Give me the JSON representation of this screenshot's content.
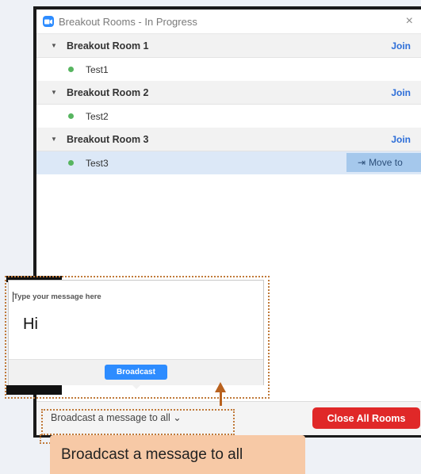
{
  "window": {
    "title": "Breakout Rooms - In Progress",
    "close_glyph": "×"
  },
  "rooms": [
    {
      "name": "Breakout Room 1",
      "join": "Join",
      "participant": "Test1"
    },
    {
      "name": "Breakout Room 2",
      "join": "Join",
      "participant": "Test2"
    },
    {
      "name": "Breakout Room 3",
      "join": "Join",
      "participant": "Test3"
    }
  ],
  "selected_participant_action": {
    "label": "Move to",
    "icon": "move-to-icon"
  },
  "broadcast_popup": {
    "placeholder": "Type your message here",
    "message": "Hi",
    "button": "Broadcast"
  },
  "footer": {
    "broadcast_toggle": "Broadcast a message to all ⌄",
    "close_all": "Close All Rooms"
  },
  "callout": {
    "text": "Broadcast a message to all"
  },
  "colors": {
    "accent": "#2d8cff",
    "join_link": "#2d6ed8",
    "danger": "#e02828",
    "online": "#57b560",
    "annotation": "#b9621f",
    "callout_bg": "#f7c9a6"
  }
}
